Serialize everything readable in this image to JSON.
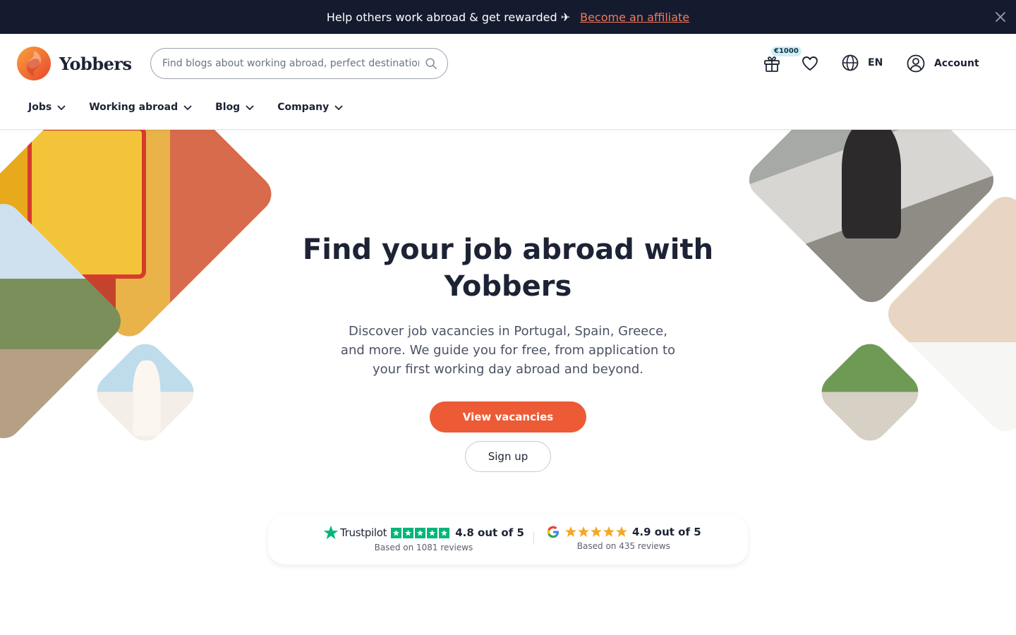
{
  "banner": {
    "text": "Help others work abroad & get rewarded ✈",
    "link": "Become an affiliate",
    "close_icon": "close-icon"
  },
  "header": {
    "logo_text": "Yobbers",
    "search_placeholder": "Find blogs about working abroad, perfect destinations, ...",
    "gift_badge": "€1000",
    "language": "EN",
    "account_label": "Account",
    "icons": [
      "logo-icon",
      "search-icon",
      "gift-icon",
      "heart-icon",
      "globe-icon",
      "user-icon"
    ]
  },
  "nav": {
    "items": [
      {
        "label": "Jobs"
      },
      {
        "label": "Working abroad"
      },
      {
        "label": "Blog"
      },
      {
        "label": "Company"
      }
    ]
  },
  "hero": {
    "title": "Find your job abroad with Yobbers",
    "subtitle": "Discover job vacancies in Portugal, Spain, Greece, and more. We guide you for free, from application to your first working day abroad and beyond.",
    "primary_button": "View vacancies",
    "secondary_button": "Sign up"
  },
  "reviews": {
    "trustpilot": {
      "brand": "Trustpilot",
      "score": "4.8 out of 5",
      "count": "Based on 1081 reviews",
      "star_color": "#00b67a"
    },
    "google": {
      "score": "4.9 out of 5",
      "count": "Based on 435 reviews",
      "star_color": "#f5a623"
    }
  },
  "colors": {
    "accent": "#ec5b36",
    "banner_bg": "#141b2f",
    "link": "#f0795c",
    "text": "#1d2335"
  }
}
